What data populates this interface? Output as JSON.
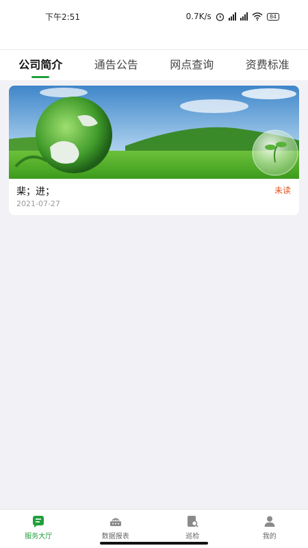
{
  "status_bar": {
    "time": "下午2:51",
    "net_speed": "0.7K/s",
    "battery": "84"
  },
  "tabs": [
    {
      "label": "公司简介",
      "active": true
    },
    {
      "label": "通告公告",
      "active": false
    },
    {
      "label": "网点查询",
      "active": false
    },
    {
      "label": "资费标准",
      "active": false
    }
  ],
  "card": {
    "image_icon": "green-globe-landscape-image",
    "title": "棐；进；",
    "date": "2021-07-27",
    "badge": "未读"
  },
  "bottom_nav": [
    {
      "label": "服务大厅",
      "icon": "service-hall-icon",
      "active": true
    },
    {
      "label": "数据报表",
      "icon": "data-report-icon",
      "active": false
    },
    {
      "label": "巡检",
      "icon": "inspection-icon",
      "active": false
    },
    {
      "label": "我的",
      "icon": "profile-icon",
      "active": false
    }
  ],
  "colors": {
    "accent": "#21a03a",
    "unread": "#e0531e",
    "background": "#f2f2f6"
  }
}
